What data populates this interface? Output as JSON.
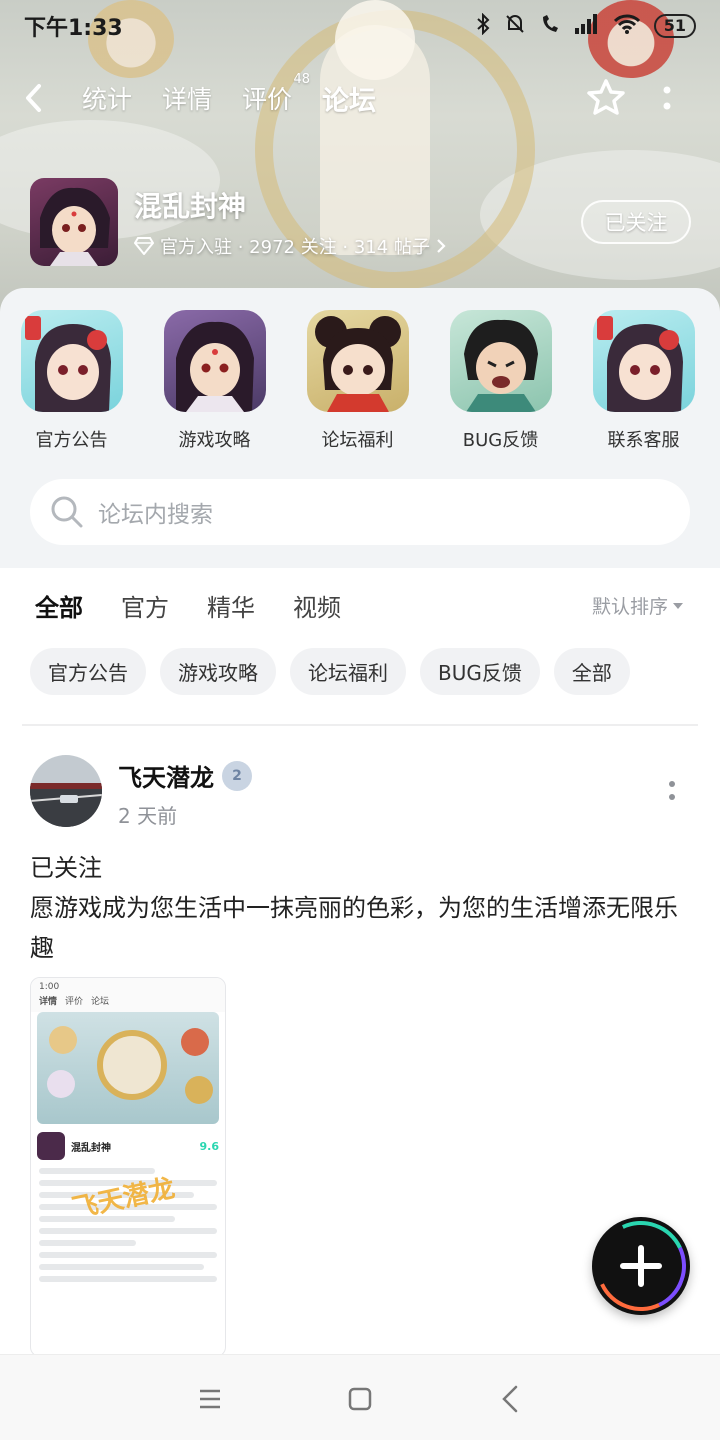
{
  "status_bar": {
    "time": "下午1:33",
    "battery": "51"
  },
  "top_nav": {
    "tabs": [
      {
        "label": "统计"
      },
      {
        "label": "详情"
      },
      {
        "label": "评价",
        "count": "48"
      },
      {
        "label": "论坛"
      }
    ]
  },
  "forum": {
    "name": "混乱封神",
    "meta": "官方入驻 · 2972 关注 · 314 帖子",
    "follow_label": "已关注"
  },
  "shortcuts": [
    {
      "label": "官方公告"
    },
    {
      "label": "游戏攻略"
    },
    {
      "label": "论坛福利"
    },
    {
      "label": "BUG反馈"
    },
    {
      "label": "联系客服"
    }
  ],
  "search": {
    "placeholder": "论坛内搜索"
  },
  "filter": {
    "tabs": [
      "全部",
      "官方",
      "精华",
      "视频"
    ],
    "sort_label": "默认排序"
  },
  "chips": [
    "官方公告",
    "游戏攻略",
    "论坛福利",
    "BUG反馈",
    "全部"
  ],
  "post": {
    "username": "飞天潜龙",
    "badge": "2",
    "time": "2 天前",
    "title": "已关注",
    "body": "愿游戏成为您生活中一抹亮丽的色彩，为您的生活增添无限乐趣",
    "image": {
      "status_time": "1:00",
      "tabs": [
        "详情",
        "评价",
        "论坛"
      ],
      "game_name": "混乱封神",
      "score": "9.6",
      "watermark": "飞天潜龙"
    }
  },
  "colors": {
    "accent": "#2ad6b0",
    "fab": "#111111"
  }
}
